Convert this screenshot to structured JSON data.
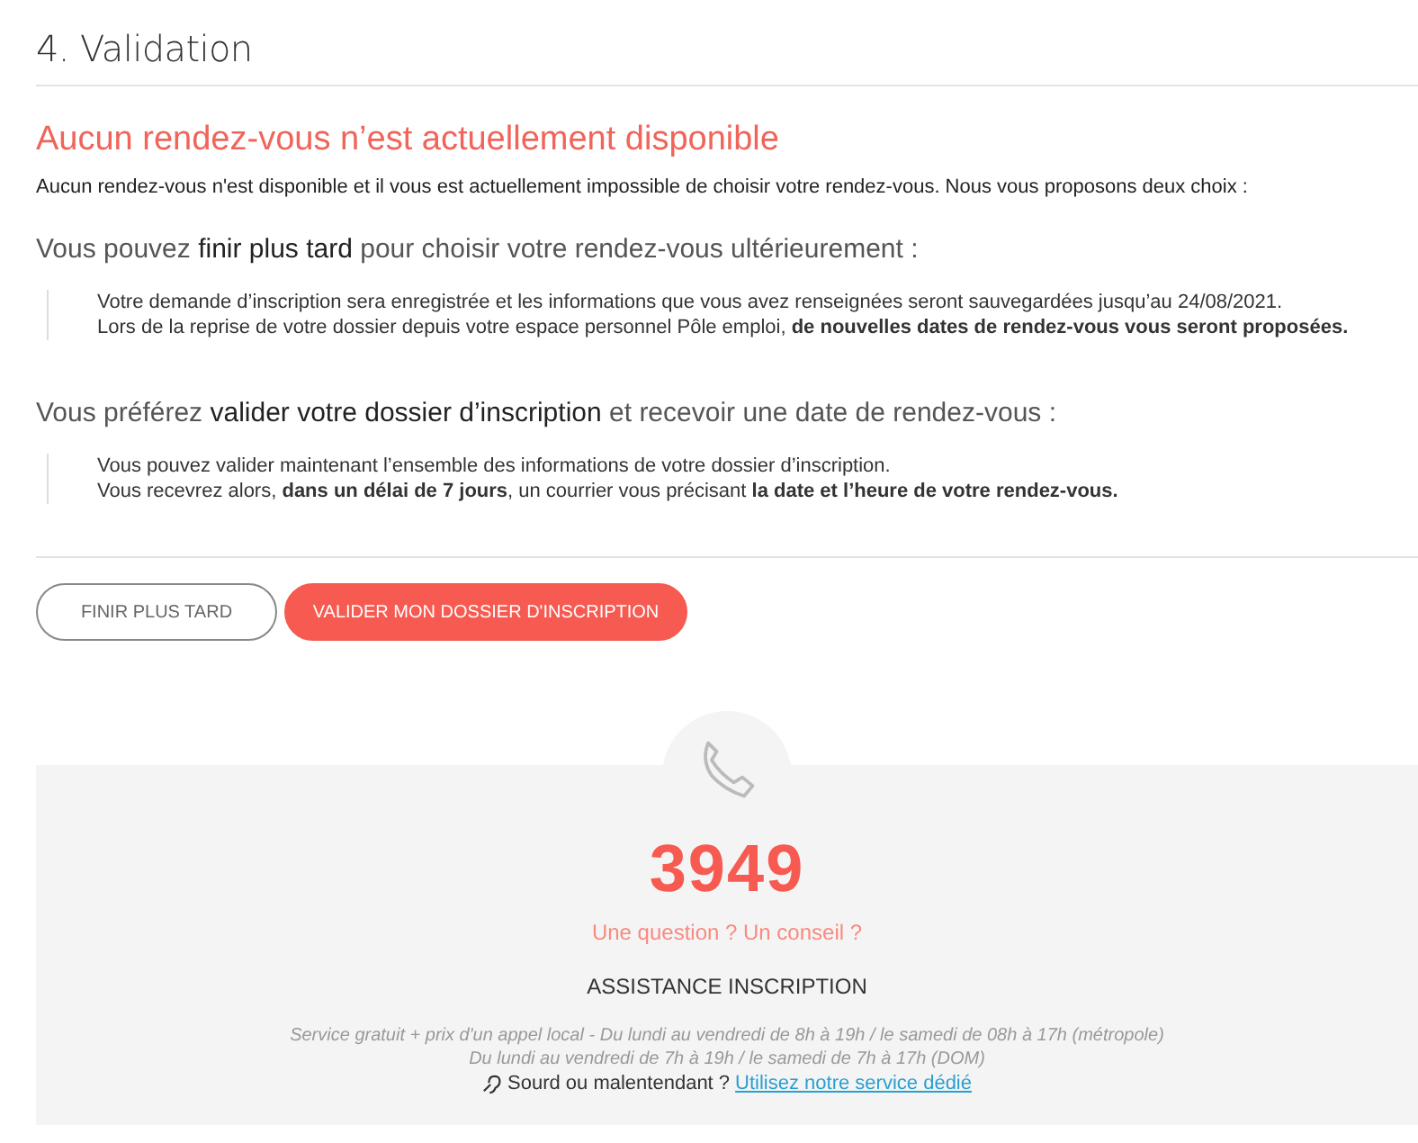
{
  "step_title": "4. Validation",
  "notice": {
    "heading": "Aucun rendez-vous n’est actuellement disponible",
    "intro": "Aucun rendez-vous n'est disponible et il vous est actuellement impossible de choisir votre rendez-vous. Nous vous proposons deux choix :"
  },
  "options": [
    {
      "lead": "Vous pouvez **finir plus tard** pour choisir votre rendez-vous ultérieurement :",
      "details": [
        "Votre demande d’inscription sera enregistrée et les informations que vous avez renseignées seront sauvegardées jusqu’au 24/08/2021.",
        "Lors de la reprise de votre dossier depuis votre espace personnel Pôle emploi, **de nouvelles dates de rendez-vous vous seront proposées.**"
      ]
    },
    {
      "lead": "Vous préférez **valider votre dossier d’inscription** et recevoir une date de rendez-vous :",
      "details": [
        "Vous pouvez valider maintenant l’ensemble des informations de votre dossier d’inscription.",
        "Vous recevrez alors, **dans un délai de 7 jours**, un courrier vous précisant **la date et l’heure de votre rendez-vous.**"
      ]
    }
  ],
  "buttons": [
    {
      "label": "FINIR PLUS TARD",
      "kind": "secondary"
    },
    {
      "label": "VALIDER MON DOSSIER D'INSCRIPTION",
      "kind": "primary"
    }
  ],
  "contact": {
    "number": "3949",
    "question": "Une question ? Un conseil ?",
    "service_title": "ASSISTANCE INSCRIPTION",
    "hours": [
      "Service gratuit + prix d'un appel local - Du lundi au vendredi de 8h à 19h / le samedi de 08h à 17h (métropole)",
      "Du lundi au vendredi de 7h à 19h / le samedi de 7h à 17h (DOM)"
    ],
    "accessibility": {
      "text": "Sourd ou malentendant ?",
      "link": "Utilisez notre service dédié"
    }
  }
}
